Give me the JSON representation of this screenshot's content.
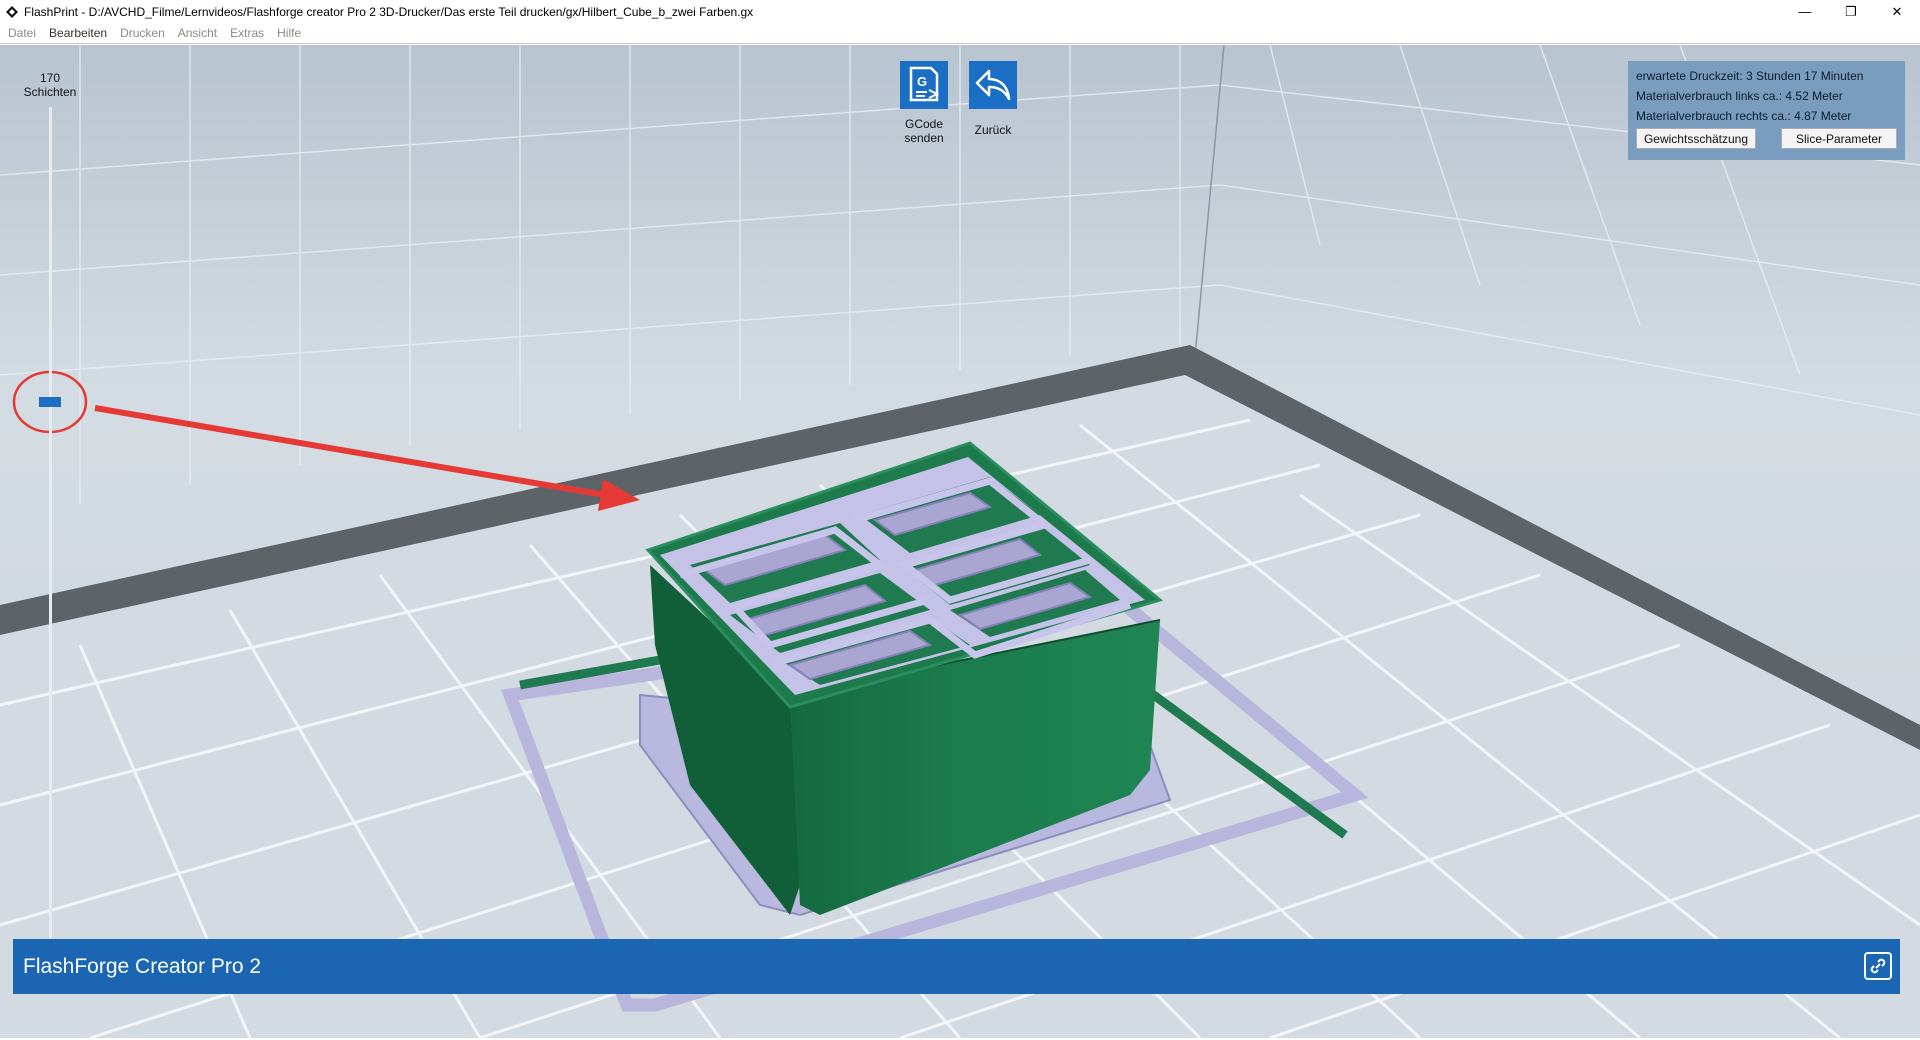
{
  "window": {
    "title": "FlashPrint - D:/AVCHD_Filme/Lernvideos/Flashforge creator Pro 2 3D-Drucker/Das erste Teil drucken/gx/Hilbert_Cube_b_zwei Farben.gx",
    "minimize": "—",
    "restore": "❐",
    "close": "✕"
  },
  "menu": {
    "items": [
      "Datei",
      "Bearbeiten",
      "Drucken",
      "Ansicht",
      "Extras",
      "Hilfe"
    ]
  },
  "layer_slider": {
    "max_value": "170",
    "max_label": "Schichten",
    "current_value": "110"
  },
  "actions": {
    "gcode": {
      "label_line1": "GCode",
      "label_line2": "senden",
      "icon": "gcode-send-icon"
    },
    "back": {
      "label": "Zurück",
      "icon": "undo-arrow-icon"
    }
  },
  "info": {
    "print_time": "erwartete Druckzeit:  3 Stunden 17 Minuten",
    "material_left": "Materialverbrauch links ca.:  4.52 Meter",
    "material_right": "Materialverbrauch rechts ca.:  4.87 Meter",
    "weight_button": "Gewichtsschätzung",
    "slice_button": "Slice-Parameter"
  },
  "statusbar": {
    "printer_name": "FlashForge Creator Pro 2",
    "link_icon": "link-icon"
  },
  "colors": {
    "accent": "#1a66b2",
    "model_green": "#1f7a4f",
    "model_lavender": "#b5b4dc",
    "annotation_red": "#e53935"
  }
}
